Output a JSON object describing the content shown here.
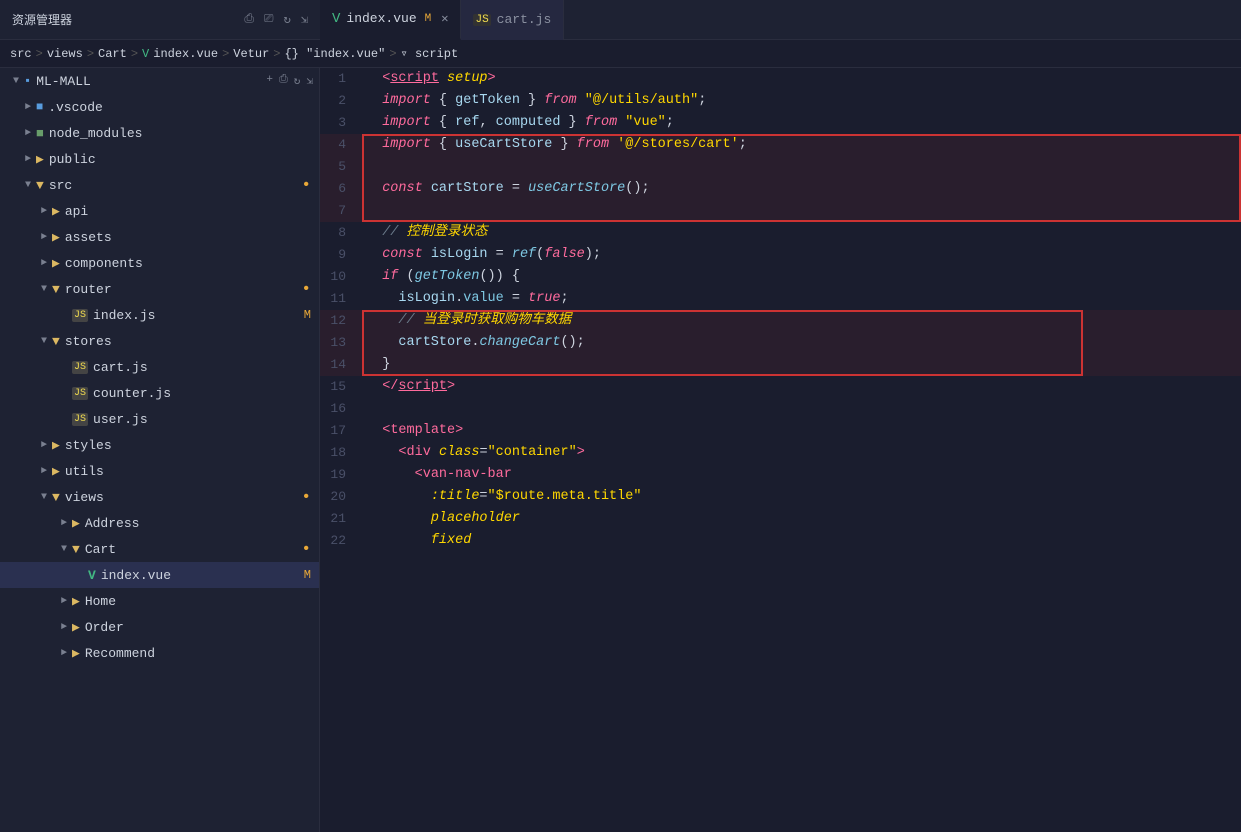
{
  "titlebar": {
    "explorer_label": "资源管理器",
    "more_icon": "•••",
    "tabs": [
      {
        "id": "index-vue",
        "icon": "vue",
        "name": "index.vue",
        "badge": "M",
        "closable": true,
        "active": true
      },
      {
        "id": "cart-js",
        "icon": "js",
        "name": "cart.js",
        "badge": null,
        "closable": false,
        "active": false
      }
    ]
  },
  "breadcrumb": {
    "parts": [
      "src",
      ">",
      "views",
      ">",
      "Cart",
      ">",
      "index.vue",
      ">",
      "Vetur",
      ">",
      "{} \"index.vue\"",
      ">",
      "script"
    ]
  },
  "sidebar": {
    "root": "ML-MALL",
    "items": [
      {
        "id": "vscode",
        "indent": 1,
        "type": "folder-special",
        "icon": "vscode",
        "name": ".vscode",
        "expanded": false,
        "modified": false
      },
      {
        "id": "node_modules",
        "indent": 1,
        "type": "folder-special",
        "icon": "node",
        "name": "node_modules",
        "expanded": false,
        "modified": false
      },
      {
        "id": "public",
        "indent": 1,
        "type": "folder",
        "name": "public",
        "expanded": false,
        "modified": false
      },
      {
        "id": "src",
        "indent": 1,
        "type": "folder",
        "name": "src",
        "expanded": true,
        "modified": true
      },
      {
        "id": "api",
        "indent": 2,
        "type": "folder",
        "name": "api",
        "expanded": false,
        "modified": false
      },
      {
        "id": "assets",
        "indent": 2,
        "type": "folder",
        "name": "assets",
        "expanded": false,
        "modified": false
      },
      {
        "id": "components",
        "indent": 2,
        "type": "folder",
        "name": "components",
        "expanded": false,
        "modified": false
      },
      {
        "id": "router",
        "indent": 2,
        "type": "folder",
        "name": "router",
        "expanded": true,
        "modified": true
      },
      {
        "id": "router-index",
        "indent": 3,
        "type": "js",
        "name": "index.js",
        "badge": "M",
        "modified": true
      },
      {
        "id": "stores",
        "indent": 2,
        "type": "folder",
        "name": "stores",
        "expanded": true,
        "modified": false
      },
      {
        "id": "stores-cart",
        "indent": 3,
        "type": "js",
        "name": "cart.js",
        "modified": false
      },
      {
        "id": "stores-counter",
        "indent": 3,
        "type": "js",
        "name": "counter.js",
        "modified": false
      },
      {
        "id": "stores-user",
        "indent": 3,
        "type": "js",
        "name": "user.js",
        "modified": false
      },
      {
        "id": "styles",
        "indent": 2,
        "type": "folder",
        "name": "styles",
        "expanded": false,
        "modified": false
      },
      {
        "id": "utils",
        "indent": 2,
        "type": "folder",
        "name": "utils",
        "expanded": false,
        "modified": false
      },
      {
        "id": "views",
        "indent": 2,
        "type": "folder",
        "name": "views",
        "expanded": true,
        "modified": true
      },
      {
        "id": "views-address",
        "indent": 3,
        "type": "folder",
        "name": "Address",
        "expanded": false,
        "modified": false
      },
      {
        "id": "views-cart",
        "indent": 3,
        "type": "folder",
        "name": "Cart",
        "expanded": true,
        "modified": true
      },
      {
        "id": "views-cart-index",
        "indent": 4,
        "type": "vue",
        "name": "index.vue",
        "badge": "M",
        "modified": true,
        "selected": true
      },
      {
        "id": "views-home",
        "indent": 3,
        "type": "folder",
        "name": "Home",
        "expanded": false,
        "modified": false
      },
      {
        "id": "views-order",
        "indent": 3,
        "type": "folder",
        "name": "Order",
        "expanded": false,
        "modified": false
      },
      {
        "id": "views-recommend",
        "indent": 3,
        "type": "folder",
        "name": "Recommend",
        "expanded": false,
        "modified": false
      }
    ]
  },
  "code": {
    "lines": [
      {
        "num": 1,
        "html": "<span class='tag'>&lt;</span><span class='script-tag'>script</span><span class='tag'>&gt;</span> <span class='attr'>setup</span><span class='tag'>&gt;</span>"
      },
      {
        "num": 2,
        "html": "  <span class='kw'>import</span> <span class='punc'>{ </span><span class='var'>getToken</span><span class='punc'> } </span><span class='kw'>from</span> <span class='str'>\"@/utils/auth\"</span><span class='punc'>;</span>"
      },
      {
        "num": 3,
        "html": "  <span class='kw'>import</span> <span class='punc'>{ </span><span class='var'>ref</span><span class='punc'>, </span><span class='var'>computed</span><span class='punc'> } </span><span class='kw'>from</span> <span class='str'>\"vue\"</span><span class='punc'>;</span>"
      },
      {
        "num": 4,
        "html": "  <span class='kw'>import</span> <span class='punc'>{ </span><span class='var'>useCartStore</span><span class='punc'> } </span><span class='kw'>from</span> <span class='str'>'@/stores/cart'</span><span class='punc'>;</span>",
        "hl": "top-left-right"
      },
      {
        "num": 5,
        "html": "",
        "hl": "left-right"
      },
      {
        "num": 6,
        "html": "  <span class='kw'>const</span> <span class='var'>cartStore</span> <span class='punc'>= </span><span class='fn'>useCartStore</span><span class='punc'>();</span>",
        "hl": "left-right"
      },
      {
        "num": 7,
        "html": "",
        "hl": "bottom-left-right"
      },
      {
        "num": 8,
        "html": "  <span class='comment'>// </span><span class='comment-zh'>控制登录状态</span>"
      },
      {
        "num": 9,
        "html": "  <span class='kw'>const</span> <span class='var'>isLogin</span> <span class='punc'>= </span><span class='fn'>ref</span><span class='punc'>(</span><span class='kw'>false</span><span class='punc'>);</span>"
      },
      {
        "num": 10,
        "html": "  <span class='kw'>if</span> <span class='punc'>(</span><span class='fn'>getToken</span><span class='punc'>()) {</span>"
      },
      {
        "num": 11,
        "html": "    <span class='var'>isLogin</span><span class='punc'>.</span><span class='attr-val'>value</span> <span class='punc'>= </span><span class='kw'>true</span><span class='punc'>;</span>"
      },
      {
        "num": 12,
        "html": "    <span class='comment'>// </span><span class='comment-zh'>当登录时获取购物车数据</span>",
        "hl": "top-left-right"
      },
      {
        "num": 13,
        "html": "    <span class='var'>cartStore</span><span class='punc'>.</span><span class='fn'>changeCart</span><span class='punc'>();</span>",
        "hl": "left-right"
      },
      {
        "num": 14,
        "html": "  <span class='punc'>}</span>",
        "hl": "bottom-left-right"
      },
      {
        "num": 15,
        "html": "  <span class='tag'>&lt;/</span><span class='script-tag'>script</span><span class='tag'>&gt;</span>"
      },
      {
        "num": 16,
        "html": ""
      },
      {
        "num": 17,
        "html": "  <span class='tag'>&lt;</span><span class='tag-name'>template</span><span class='tag'>&gt;</span>"
      },
      {
        "num": 18,
        "html": "    <span class='tag'>&lt;</span><span class='tag-name'>div</span> <span class='attr'>class</span><span class='punc'>=</span><span class='str'>\"container\"</span><span class='tag'>&gt;</span>"
      },
      {
        "num": 19,
        "html": "      <span class='tag'>&lt;</span><span class='tag-name'>van-nav-bar</span>"
      },
      {
        "num": 20,
        "html": "        <span class='attr'>:title</span><span class='punc'>=</span><span class='str'>\"$route.meta.title\"</span>"
      },
      {
        "num": 21,
        "html": "        <span class='attr'>placeholder</span>"
      },
      {
        "num": 22,
        "html": "        <span class='attr'>fixed</span>"
      }
    ]
  }
}
